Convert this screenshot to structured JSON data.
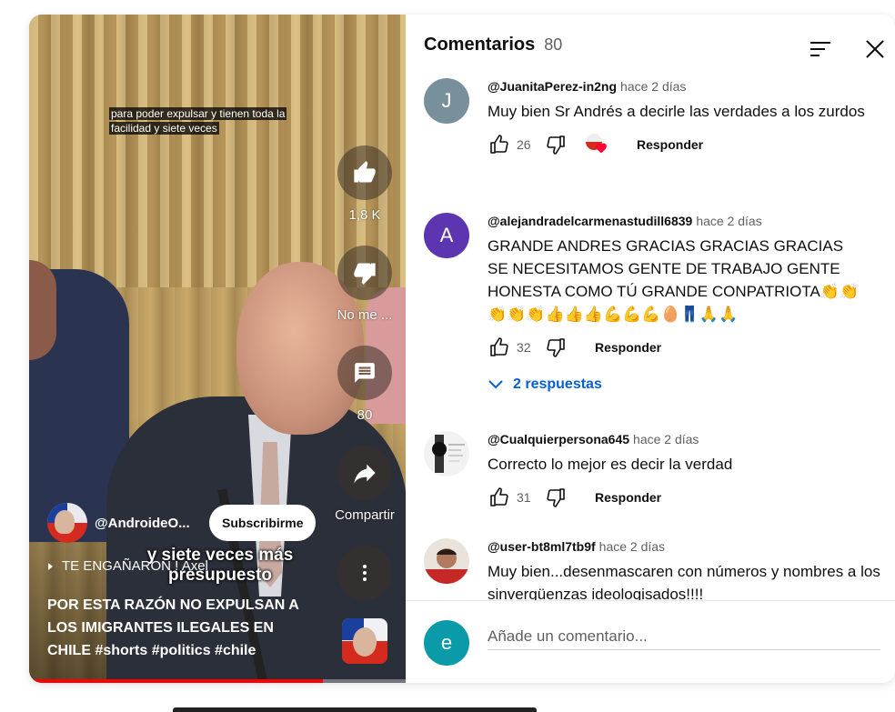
{
  "video": {
    "caption_top": "para poder expulsar y tienen toda la facilidad y siete veces",
    "caption_mid": "y siete veces más presupuesto",
    "like_count": "1,8 K",
    "dislike_label": "No me ...",
    "comments_count": "80",
    "share_label": "Compartir",
    "channel_name": "@AndroideO...",
    "subscribe_label": "Subscribirme",
    "music_text": "TE ENGAÑARON ! Axel",
    "title": "POR ESTA RAZÓN NO EXPULSAN A LOS IMIGRANTES ILEGALES EN CHILE #shorts #politics #chile",
    "progress_fraction": 0.78
  },
  "comments_panel": {
    "title": "Comentarios",
    "count": "80",
    "add_comment_avatar_letter": "e",
    "add_comment_placeholder": "Añade un comentario...",
    "comments": [
      {
        "avatar_letter": "J",
        "avatar_color": "#78909c",
        "author": "@JuanitaPerez-in2ng",
        "time": "hace 2 días",
        "text": "Muy bien Sr Andrés a decirle las verdades a los zurdos",
        "likes": "26",
        "reply_label": "Responder"
      },
      {
        "avatar_letter": "A",
        "avatar_color": "#5e35b1",
        "author": "@alejandradelcarmenastudill6839",
        "time": "hace 2 días",
        "text": "GRANDE ANDRES GRACIAS GRACIAS GRACIAS SE NECESITAMOS GENTE DE TRABAJO GENTE HONESTA COMO TÚ GRANDE CONPATRIOTA👏👏👏👏👏👍👍👍💪💪💪🥚👖🙏🙏",
        "likes": "32",
        "reply_label": "Responder",
        "replies_label": "2 respuestas"
      },
      {
        "avatar_letter": "",
        "avatar_color": "#f2f2f2",
        "author": "@Cualquierpersona645",
        "time": "hace 2 días",
        "text": "Correcto lo mejor es decir la verdad",
        "likes": "31",
        "reply_label": "Responder"
      },
      {
        "avatar_letter": "",
        "avatar_color": "#c0392b",
        "author": "@user-bt8ml7tb9f",
        "time": "hace 2 días",
        "text": "Muy bien...desenmascaren con números y nombres a los sinvergüenzas ideologisados!!!!"
      }
    ]
  }
}
